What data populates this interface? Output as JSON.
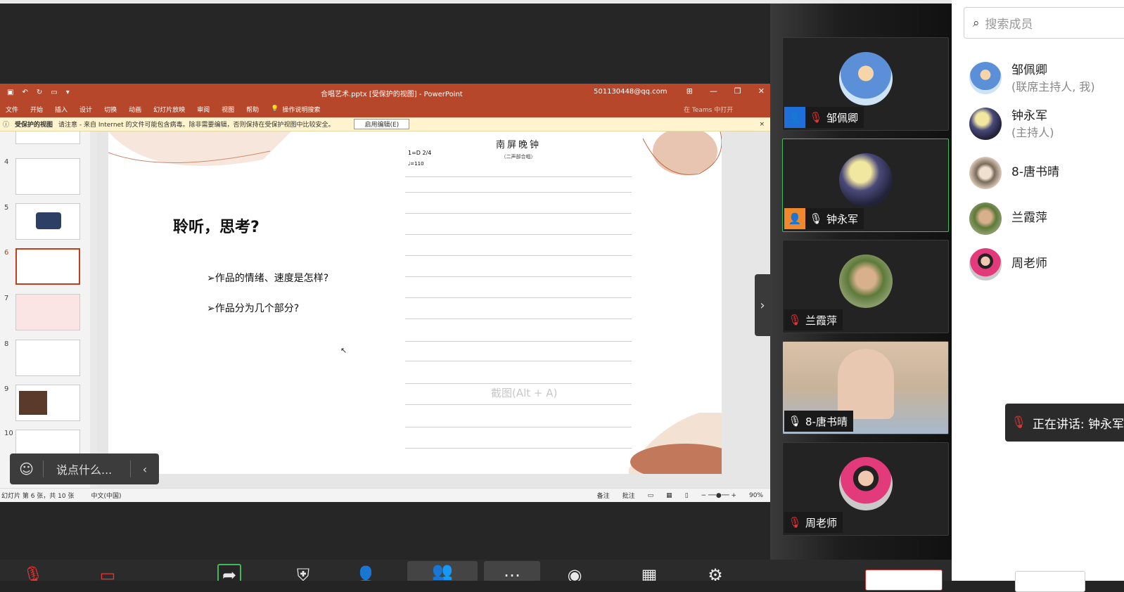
{
  "ppt": {
    "document_title": "合唱艺术.pptx [受保护的视图] - PowerPoint",
    "account": "501130448@qq.com",
    "ribbon_tabs": [
      "文件",
      "开始",
      "插入",
      "设计",
      "切换",
      "动画",
      "幻灯片放映",
      "审阅",
      "视图",
      "帮助"
    ],
    "tell_me": "操作说明搜索",
    "teams": "在 Teams 中打开",
    "message_bar": {
      "title": "受保护的视图",
      "text": "请注意 - 来自 Internet 的文件可能包含病毒。除非需要编辑，否则保持在受保护视图中比较安全。",
      "button": "启用编辑(E)"
    },
    "slide_numbers": [
      "4",
      "5",
      "6",
      "7",
      "8",
      "9",
      "10"
    ],
    "slide": {
      "heading": "聆听，思考?",
      "bullet1": "➢作品的情绪、速度是怎样?",
      "bullet2": "➢作品分为几个部分?",
      "score_title": "南屏晚钟",
      "score_subtitle": "（二声部合唱）",
      "score_key": "1=D 2/4",
      "score_tempo": "♩=110"
    },
    "ghost_text": "截图(Alt + A)",
    "status": {
      "slide_info": "幻灯片 第 6 张，共 10 张",
      "language": "中文(中国)",
      "notes": "备注",
      "comments": "批注",
      "zoom": "90%"
    }
  },
  "chat": {
    "placeholder": "说点什么..."
  },
  "videos": [
    {
      "name": "邹佩卿",
      "muted": true,
      "host_badge": true
    },
    {
      "name": "钟永军",
      "muted": false,
      "host_badge": true
    },
    {
      "name": "兰霞萍",
      "muted": true,
      "host_badge": false
    },
    {
      "name": "8-唐书晴",
      "muted": false,
      "host_badge": false
    },
    {
      "name": "周老师",
      "muted": true,
      "host_badge": false
    }
  ],
  "panel": {
    "search_placeholder": "搜索成员",
    "members": [
      {
        "name": "邹佩卿",
        "role": "(联席主持人, 我)"
      },
      {
        "name": "钟永军",
        "role": "(主持人)"
      },
      {
        "name": "8-唐书晴",
        "role": ""
      },
      {
        "name": "兰霞萍",
        "role": ""
      },
      {
        "name": "周老师",
        "role": ""
      }
    ],
    "speaking": "正在讲话: 钟永军"
  },
  "colors": {
    "ppt_red": "#b7472a",
    "active_green": "#3dbb5a",
    "dark_bg": "#262626"
  }
}
